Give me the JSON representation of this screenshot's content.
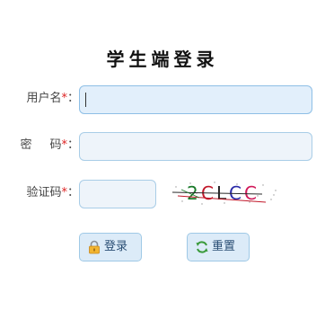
{
  "title": "学生端登录",
  "form": {
    "username": {
      "label": "用户名",
      "required_mark": "*",
      "suffix": "：",
      "value": ""
    },
    "password": {
      "label": "密码",
      "required_mark": "*",
      "suffix": "：",
      "value": ""
    },
    "captcha": {
      "label": "验证码",
      "required_mark": "*",
      "suffix": "：",
      "value": "",
      "image_text": "2CLCC"
    }
  },
  "buttons": {
    "login": {
      "label": "登录",
      "icon": "lock-icon"
    },
    "reset": {
      "label": "重置",
      "icon": "refresh-icon"
    }
  },
  "colors": {
    "required": "#dd2222",
    "input_border": "#a9cde7",
    "button_bg": "#dcebf8"
  }
}
